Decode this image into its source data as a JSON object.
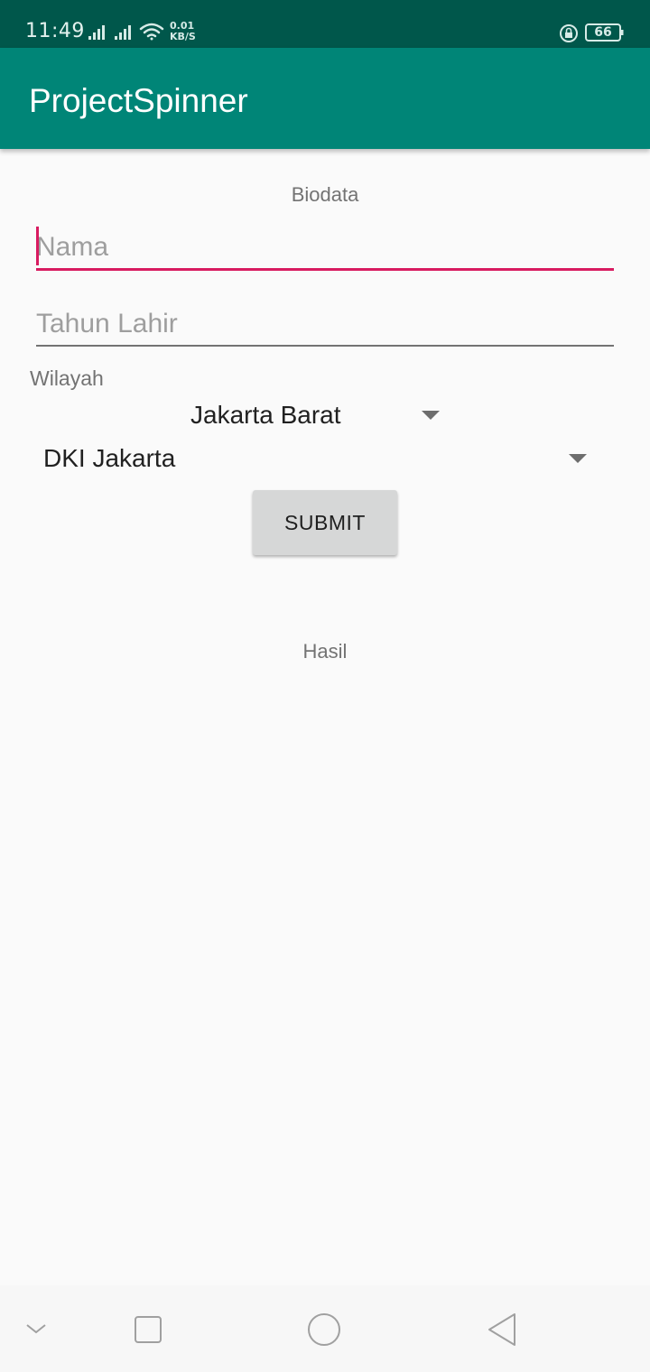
{
  "status_bar": {
    "time": "11:49",
    "speed_value": "0.01",
    "speed_unit": "KB/S",
    "battery": "66"
  },
  "app_bar": {
    "title": "ProjectSpinner"
  },
  "form": {
    "heading": "Biodata",
    "name_placeholder": "Nama",
    "birth_year_placeholder": "Tahun Lahir",
    "region_label": "Wilayah",
    "city_selected": "Jakarta Barat",
    "province_selected": "DKI Jakarta",
    "submit_label": "SUBMIT",
    "result_label": "Hasil"
  },
  "colors": {
    "status_bar": "#00574b",
    "app_bar": "#008577",
    "accent": "#d81b60"
  },
  "nav_bar": {
    "icons": [
      "chevron-down-icon",
      "recents-square-icon",
      "home-circle-icon",
      "back-triangle-icon"
    ]
  }
}
